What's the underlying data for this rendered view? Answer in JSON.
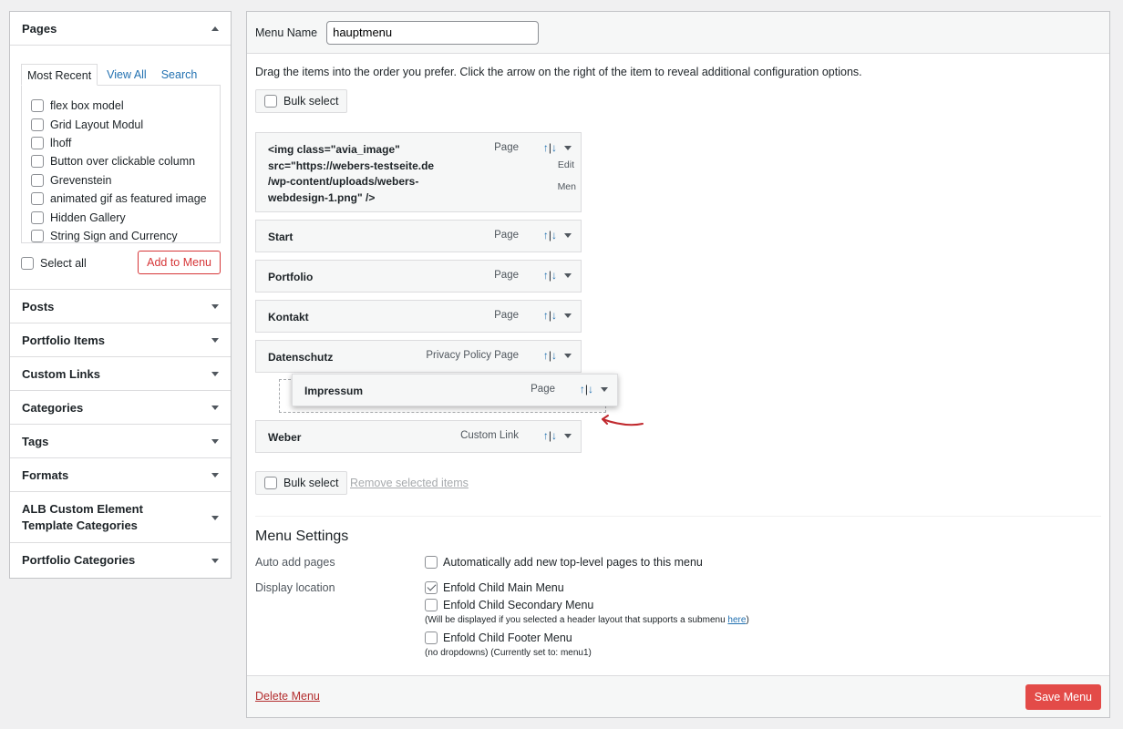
{
  "sidebar": {
    "pages": {
      "title": "Pages",
      "tabs": [
        "Most Recent",
        "View All",
        "Search"
      ],
      "items": [
        "flex box model",
        "Grid Layout Modul",
        "lhoff",
        "Button over clickable column",
        "Grevenstein",
        "animated gif as featured image",
        "Hidden Gallery",
        "String Sign and Currency"
      ],
      "select_all": "Select all",
      "add_button": "Add to Menu"
    },
    "sections": [
      "Posts",
      "Portfolio Items",
      "Custom Links",
      "Categories",
      "Tags",
      "Formats",
      "ALB Custom Element Template Categories",
      "Portfolio Categories"
    ]
  },
  "menu": {
    "name_label": "Menu Name",
    "name_value": "hauptmenu",
    "instructions": "Drag the items into the order you prefer. Click the arrow on the right of the item to reveal additional configuration options.",
    "bulk_select": "Bulk select",
    "remove_selected": "Remove selected items",
    "arrows": {
      "up": "↑",
      "sep": "|",
      "down": "↓"
    },
    "edit_label": "Edit",
    "men_label": "Men",
    "items": [
      {
        "title": "<img class=\"avia_image\" src=\"https://webers-testseite.de /wp-content/uploads/webers-webdesign-1.png\" />",
        "type": "Page"
      },
      {
        "title": "Start",
        "type": "Page"
      },
      {
        "title": "Portfolio",
        "type": "Page"
      },
      {
        "title": "Kontakt",
        "type": "Page"
      },
      {
        "title": "Datenschutz",
        "type": "Privacy Policy Page"
      },
      {
        "title": "Impressum",
        "type": "Page"
      },
      {
        "title": "Weber",
        "type": "Custom Link"
      }
    ]
  },
  "settings": {
    "title": "Menu Settings",
    "auto_add_label": "Auto add pages",
    "auto_add_option": "Automatically add new top-level pages to this menu",
    "display_label": "Display location",
    "locations": [
      {
        "label": "Enfold Child Main Menu",
        "checked": true
      },
      {
        "label": "Enfold Child Secondary Menu",
        "checked": false
      },
      {
        "label": "Enfold Child Footer Menu",
        "checked": false
      }
    ],
    "secondary_note_pre": "(Will be displayed if you selected a header layout that supports a submenu ",
    "secondary_note_link": "here",
    "secondary_note_post": ")",
    "footer_note": "(no dropdowns)",
    "footer_note_current": "(Currently set to: menu1)"
  },
  "footer": {
    "delete": "Delete Menu",
    "save": "Save Menu"
  },
  "colors": {
    "accent": "#2271b1",
    "save": "#e34b48",
    "add_border": "#d63638",
    "arrow_annotation": "#c0282d"
  }
}
